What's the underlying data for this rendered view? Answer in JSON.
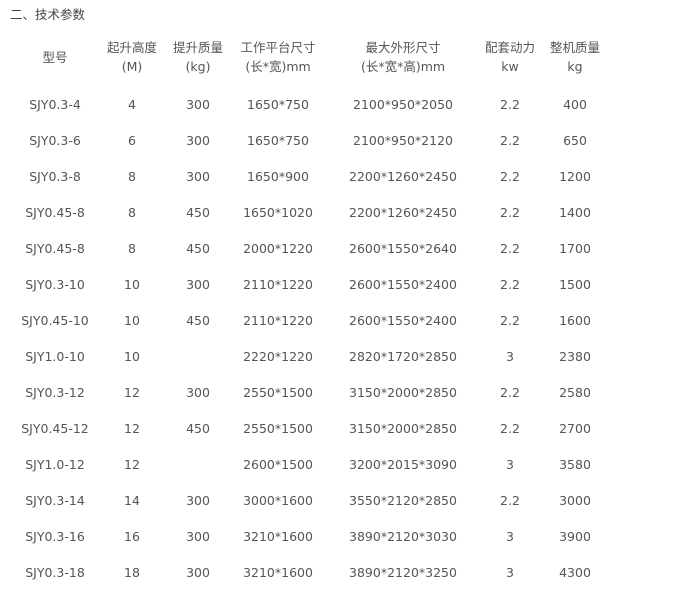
{
  "section_title": "二、技术参数",
  "table": {
    "headers": [
      {
        "line1": "型号",
        "line2": ""
      },
      {
        "line1": "起升高度",
        "line2": "(M)"
      },
      {
        "line1": "提升质量",
        "line2": "(kg)"
      },
      {
        "line1": "工作平台尺寸",
        "line2": "(长*宽)mm"
      },
      {
        "line1": "最大外形尺寸",
        "line2": "(长*宽*高)mm"
      },
      {
        "line1": "配套动力",
        "line2": "kw"
      },
      {
        "line1": "整机质量",
        "line2": "kg"
      }
    ],
    "rows": [
      [
        "SJY0.3-4",
        "4",
        "300",
        "1650*750",
        "2100*950*2050",
        "2.2",
        "400"
      ],
      [
        "SJY0.3-6",
        "6",
        "300",
        "1650*750",
        "2100*950*2120",
        "2.2",
        "650"
      ],
      [
        "SJY0.3-8",
        "8",
        "300",
        "1650*900",
        "2200*1260*2450",
        "2.2",
        "1200"
      ],
      [
        "SJY0.45-8",
        "8",
        "450",
        "1650*1020",
        "2200*1260*2450",
        "2.2",
        "1400"
      ],
      [
        "SJY0.45-8",
        "8",
        "450",
        "2000*1220",
        "2600*1550*2640",
        "2.2",
        "1700"
      ],
      [
        "SJY0.3-10",
        "10",
        "300",
        "2110*1220",
        "2600*1550*2400",
        "2.2",
        "1500"
      ],
      [
        "SJY0.45-10",
        "10",
        "450",
        "2110*1220",
        "2600*1550*2400",
        "2.2",
        "1600"
      ],
      [
        "SJY1.0-10",
        "10",
        "",
        "2220*1220",
        "2820*1720*2850",
        "3",
        "2380"
      ],
      [
        "SJY0.3-12",
        "12",
        "300",
        "2550*1500",
        "3150*2000*2850",
        "2.2",
        "2580"
      ],
      [
        "SJY0.45-12",
        "12",
        "450",
        "2550*1500",
        "3150*2000*2850",
        "2.2",
        "2700"
      ],
      [
        "SJY1.0-12",
        "12",
        "",
        "2600*1500",
        "3200*2015*3090",
        "3",
        "3580"
      ],
      [
        "SJY0.3-14",
        "14",
        "300",
        "3000*1600",
        "3550*2120*2850",
        "2.2",
        "3000"
      ],
      [
        "SJY0.3-16",
        "16",
        "300",
        "3210*1600",
        "3890*2120*3030",
        "3",
        "3900"
      ],
      [
        "SJY0.3-18",
        "18",
        "300",
        "3210*1600",
        "3890*2120*3250",
        "3",
        "4300"
      ]
    ]
  }
}
